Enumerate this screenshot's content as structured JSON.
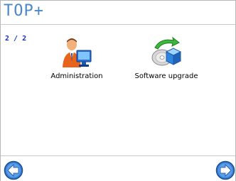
{
  "header": {
    "title": "TOP+"
  },
  "pager": {
    "indicator": "2 / 2"
  },
  "apps": [
    {
      "label": "Administration",
      "icon": "admin-user-computer-icon"
    },
    {
      "label": "Software upgrade",
      "icon": "software-upgrade-disc-icon"
    }
  ],
  "nav": {
    "prev_icon": "arrow-left-icon",
    "next_icon": "arrow-right-icon"
  },
  "colors": {
    "title": "#4a88c7",
    "nav_arrow": "#3a7fd5",
    "indicator": "#1030c0"
  }
}
